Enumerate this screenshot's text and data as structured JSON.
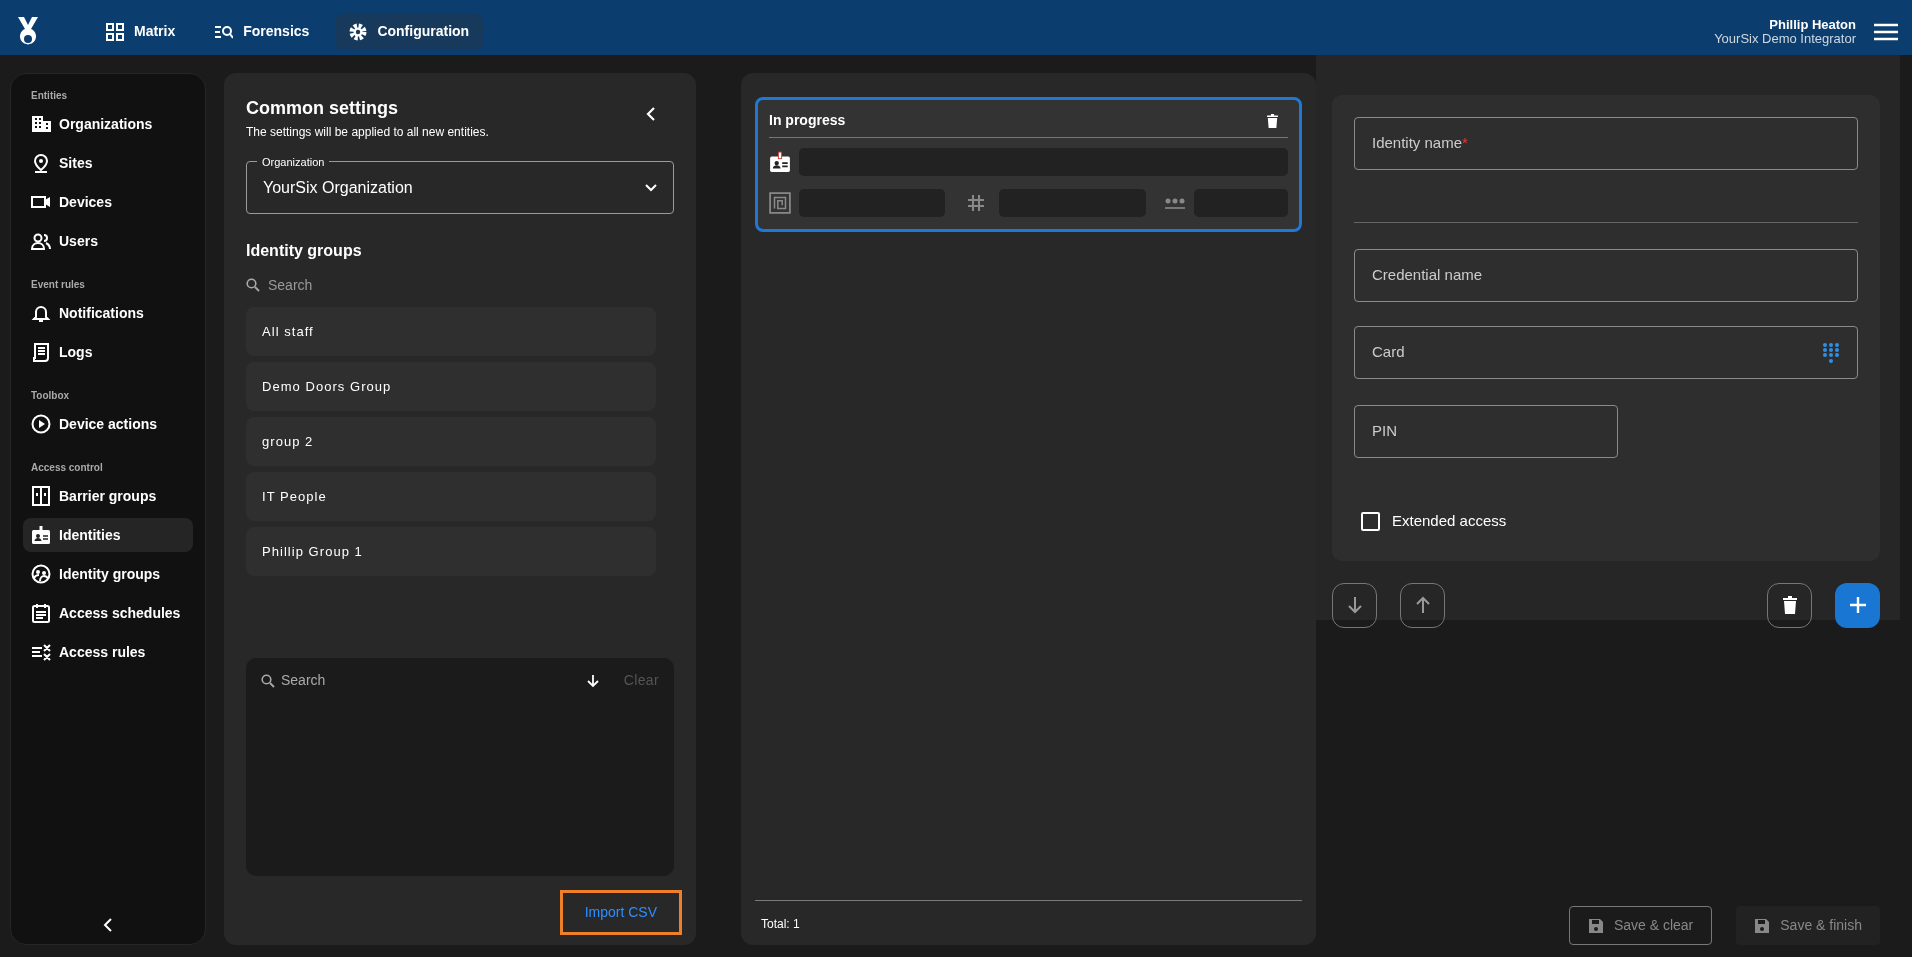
{
  "nav_tabs": [
    {
      "label": "Matrix",
      "selected": false
    },
    {
      "label": "Forensics",
      "selected": false
    },
    {
      "label": "Configuration",
      "selected": true
    }
  ],
  "user": {
    "name": "Phillip Heaton",
    "role": "YourSix Demo Integrator"
  },
  "sidebar": {
    "sections": [
      {
        "heading": "Entities",
        "items": [
          {
            "label": "Organizations",
            "selected": false
          },
          {
            "label": "Sites",
            "selected": false
          },
          {
            "label": "Devices",
            "selected": false
          },
          {
            "label": "Users",
            "selected": false
          }
        ]
      },
      {
        "heading": "Event rules",
        "items": [
          {
            "label": "Notifications",
            "selected": false
          },
          {
            "label": "Logs",
            "selected": false
          }
        ]
      },
      {
        "heading": "Toolbox",
        "items": [
          {
            "label": "Device actions",
            "selected": false
          }
        ]
      },
      {
        "heading": "Access control",
        "items": [
          {
            "label": "Barrier groups",
            "selected": false
          },
          {
            "label": "Identities",
            "selected": true
          },
          {
            "label": "Identity groups",
            "selected": false
          },
          {
            "label": "Access schedules",
            "selected": false
          },
          {
            "label": "Access rules",
            "selected": false
          }
        ]
      }
    ]
  },
  "common_settings": {
    "title": "Common settings",
    "subtitle": "The settings will be applied to all new entities.",
    "organization": {
      "label": "Organization",
      "value": "YourSix Organization"
    },
    "identity_groups": {
      "title": "Identity groups",
      "search_placeholder": "Search",
      "items": [
        {
          "label": "All staff",
          "selected": false
        },
        {
          "label": "Demo Doors Group",
          "selected": false
        },
        {
          "label": "group 2",
          "selected": false
        },
        {
          "label": "IT People",
          "selected": false
        },
        {
          "label": "Phillip Group 1",
          "selected": false
        }
      ]
    },
    "selected_groups": {
      "search_placeholder": "Search",
      "clear": "Clear"
    },
    "import_button": "Import CSV"
  },
  "batch": {
    "cards": [
      {
        "status": "In progress",
        "selected": true
      }
    ],
    "total": "Total: 1"
  },
  "form": {
    "fields": [
      {
        "kind": "text",
        "label": "Identity name",
        "required_mark": "*"
      },
      {
        "kind": "divider"
      },
      {
        "kind": "text",
        "label": "Credential name"
      },
      {
        "kind": "card",
        "label": "Card"
      },
      {
        "kind": "pin",
        "label": "PIN"
      }
    ],
    "checkbox": {
      "label": "Extended access",
      "checked": false
    }
  },
  "footer_buttons": [
    {
      "label": "Save & clear",
      "kind": "outlined",
      "disabled": true
    },
    {
      "label": "Save & finish",
      "kind": "filled",
      "disabled": true
    }
  ]
}
